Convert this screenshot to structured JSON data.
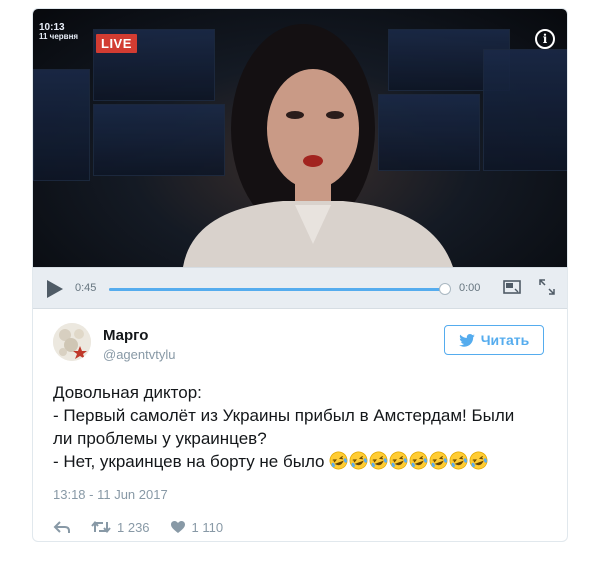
{
  "video": {
    "overlay_time": "10:13",
    "overlay_date": "11 червня",
    "live_label": "LIVE",
    "elapsed": "0:45",
    "remaining": "0:00",
    "progress": 1.0
  },
  "tweet": {
    "display_name": "Марго",
    "handle": "@agentvtylu",
    "follow_label": "Читать",
    "lines": [
      "Довольная диктор:",
      "- Первый самолёт из Украины прибыл в Амстердам! Были",
      "ли проблемы у украинцев?",
      "- Нет, украинцев на борту не было"
    ],
    "emoji_count": 8,
    "emoji_name": "rofl-emoji",
    "timestamp": "13:18 - 11 Jun 2017",
    "retweets": "1 236",
    "likes": "1 110"
  },
  "colors": {
    "accent": "#55acee",
    "live": "#d23c32",
    "muted": "#8899a6",
    "control_bg": "#e8edf2"
  },
  "icons": [
    "info-icon",
    "play-icon",
    "picture-in-picture-icon",
    "fullscreen-icon",
    "twitter-bird-icon",
    "reply-icon",
    "retweet-icon",
    "heart-icon"
  ]
}
